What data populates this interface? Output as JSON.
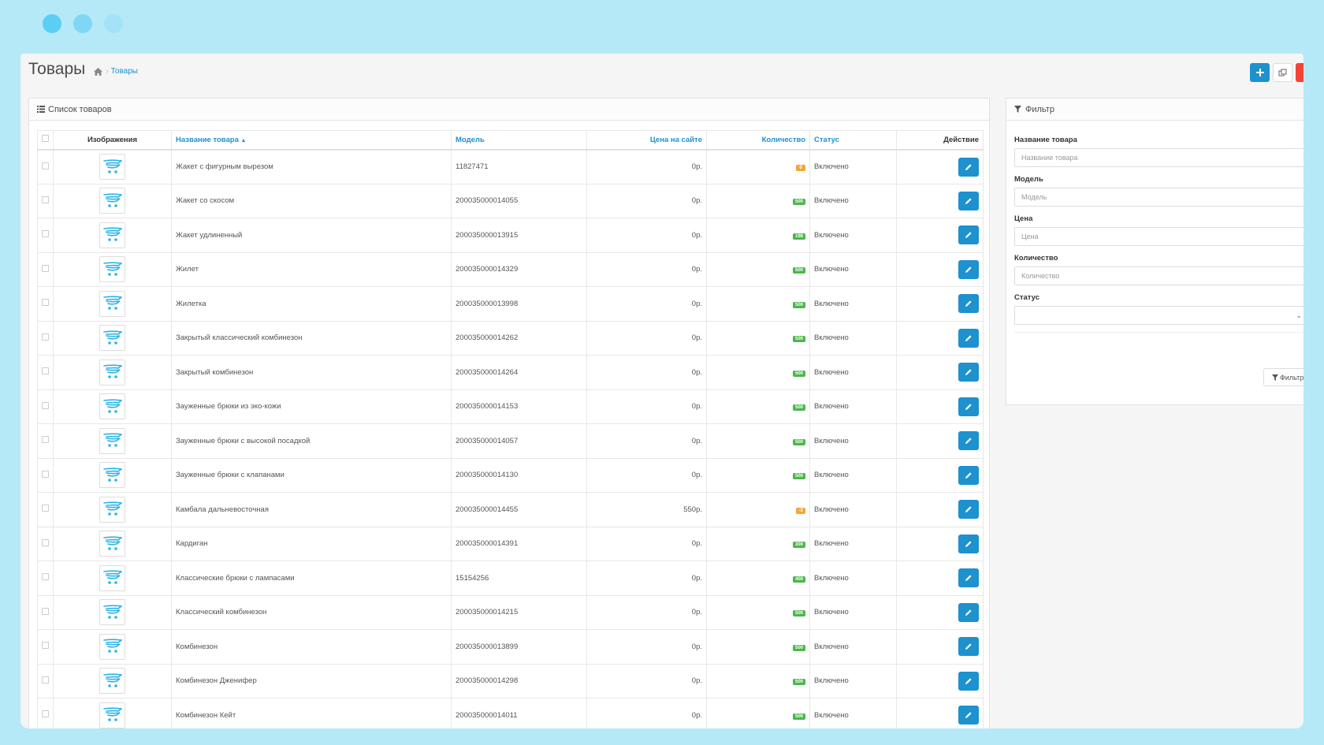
{
  "header": {
    "title": "Товары",
    "breadcrumb": "Товары"
  },
  "list": {
    "heading": "Список товаров",
    "columns": {
      "image": "Изображения",
      "name": "Название товара",
      "model": "Модель",
      "price": "Цена на сайте",
      "quantity": "Количество",
      "status": "Статус",
      "action": "Действие"
    },
    "rows": [
      {
        "name": "Жакет с фигурным вырезом",
        "model": "11827471",
        "price": "0р.",
        "qty": "0",
        "qty_state": "warn",
        "status": "Включено"
      },
      {
        "name": "Жакет со скосом",
        "model": "200035000014055",
        "price": "0р.",
        "qty": "500",
        "qty_state": "ok",
        "status": "Включено"
      },
      {
        "name": "Жакет удлиненный",
        "model": "200035000013915",
        "price": "0р.",
        "qty": "198",
        "qty_state": "ok",
        "status": "Включено"
      },
      {
        "name": "Жилет",
        "model": "200035000014329",
        "price": "0р.",
        "qty": "500",
        "qty_state": "ok",
        "status": "Включено"
      },
      {
        "name": "Жилетка",
        "model": "200035000013998",
        "price": "0р.",
        "qty": "500",
        "qty_state": "ok",
        "status": "Включено"
      },
      {
        "name": "Закрытый классический комбинезон",
        "model": "200035000014262",
        "price": "0р.",
        "qty": "500",
        "qty_state": "ok",
        "status": "Включено"
      },
      {
        "name": "Закрытый комбинезон",
        "model": "200035000014264",
        "price": "0р.",
        "qty": "500",
        "qty_state": "ok",
        "status": "Включено"
      },
      {
        "name": "Зауженные брюки из эко-кожи",
        "model": "200035000014153",
        "price": "0р.",
        "qty": "500",
        "qty_state": "ok",
        "status": "Включено"
      },
      {
        "name": "Зауженные брюки с высокой посадкой",
        "model": "200035000014057",
        "price": "0р.",
        "qty": "500",
        "qty_state": "ok",
        "status": "Включено"
      },
      {
        "name": "Зауженные брюки с клапанами",
        "model": "200035000014130",
        "price": "0р.",
        "qty": "500",
        "qty_state": "ok",
        "status": "Включено"
      },
      {
        "name": "Камбала дальневосточная",
        "model": "200035000014455",
        "price": "550р.",
        "qty": "-3",
        "qty_state": "warn",
        "status": "Включено"
      },
      {
        "name": "Кардиган",
        "model": "200035000014391",
        "price": "0р.",
        "qty": "300",
        "qty_state": "ok",
        "status": "Включено"
      },
      {
        "name": "Классические брюки с лампасами",
        "model": "15154256",
        "price": "0р.",
        "qty": "400",
        "qty_state": "ok",
        "status": "Включено"
      },
      {
        "name": "Классический комбинезон",
        "model": "200035000014215",
        "price": "0р.",
        "qty": "500",
        "qty_state": "ok",
        "status": "Включено"
      },
      {
        "name": "Комбинезон",
        "model": "200035000013899",
        "price": "0р.",
        "qty": "500",
        "qty_state": "ok",
        "status": "Включено"
      },
      {
        "name": "Комбинезон Дженифер",
        "model": "200035000014298",
        "price": "0р.",
        "qty": "500",
        "qty_state": "ok",
        "status": "Включено"
      },
      {
        "name": "Комбинезон Кейт",
        "model": "200035000014011",
        "price": "0р.",
        "qty": "500",
        "qty_state": "ok",
        "status": "Включено"
      }
    ]
  },
  "filter": {
    "heading": "Фильтр",
    "name_label": "Название товара",
    "name_placeholder": "Название товара",
    "model_label": "Модель",
    "model_placeholder": "Модель",
    "price_label": "Цена",
    "price_placeholder": "Цена",
    "qty_label": "Количество",
    "qty_placeholder": "Количество",
    "status_label": "Статус",
    "status_value": "",
    "button": "Фильтр"
  },
  "icons": {
    "home": "home-icon",
    "list": "list-icon",
    "filter": "filter-icon",
    "add": "plus-icon",
    "copy": "copy-icon",
    "delete": "trash-icon",
    "edit": "pencil-icon",
    "thumbnail": "cart-placeholder-icon"
  },
  "colors": {
    "accent": "#1e91cf",
    "ok_badge": "#4cb64c",
    "warn_badge": "#f3a638",
    "danger": "#f44336"
  }
}
